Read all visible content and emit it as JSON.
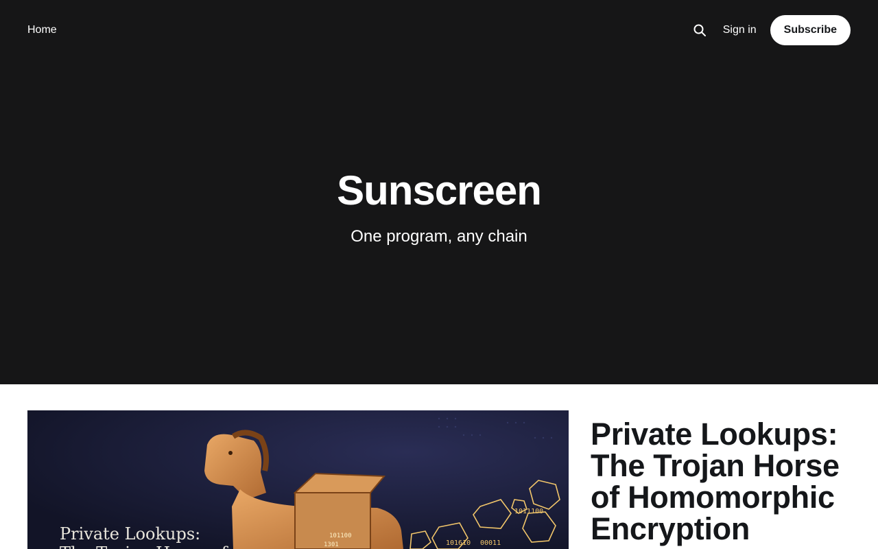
{
  "nav": {
    "home_label": "Home",
    "signin_label": "Sign in",
    "subscribe_label": "Subscribe"
  },
  "hero": {
    "title": "Sunscreen",
    "tagline": "One program, any chain"
  },
  "featured_post": {
    "title": "Private Lookups: The Trojan Horse of Homomorphic Encryption",
    "image_caption_line1": "Private Lookups:",
    "image_caption_line2": "The Trojan Horse of"
  },
  "colors": {
    "hero_bg": "#161617",
    "accent": "#ffffff",
    "text_dark": "#15171a"
  },
  "icons": {
    "search": "search-icon"
  }
}
